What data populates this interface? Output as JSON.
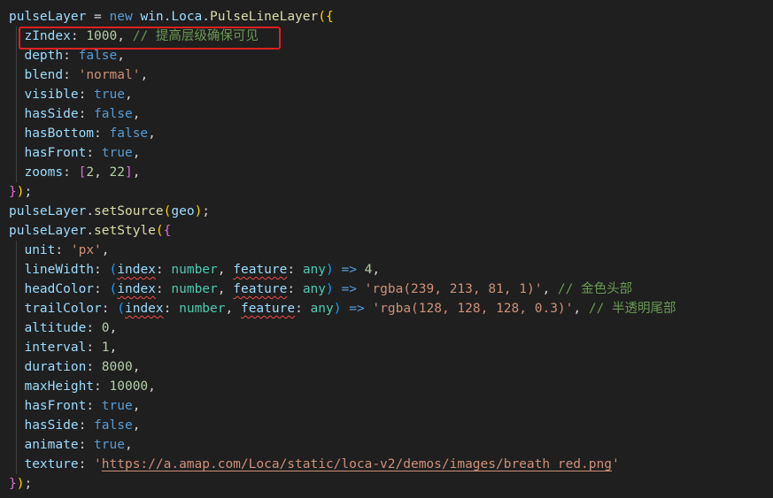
{
  "code": {
    "l1": {
      "var": "pulseLayer",
      "eq": " = ",
      "kw_new": "new",
      "ns": " win.Loca.",
      "cls": "PulseLineLayer",
      "open": "({"
    },
    "l2": {
      "key": "zIndex",
      "colon": ": ",
      "val": "1000",
      "comma": ",",
      "comment": " // 提高层级确保可见"
    },
    "l3": {
      "key": "depth",
      "colon": ": ",
      "val": "false",
      "comma": ","
    },
    "l4": {
      "key": "blend",
      "colon": ": ",
      "val": "'normal'",
      "comma": ","
    },
    "l5": {
      "key": "visible",
      "colon": ": ",
      "val": "true",
      "comma": ","
    },
    "l6": {
      "key": "hasSide",
      "colon": ": ",
      "val": "false",
      "comma": ","
    },
    "l7": {
      "key": "hasBottom",
      "colon": ": ",
      "val": "false",
      "comma": ","
    },
    "l8": {
      "key": "hasFront",
      "colon": ": ",
      "val": "true",
      "comma": ","
    },
    "l9": {
      "key": "zooms",
      "colon": ": ",
      "open": "[",
      "n1": "2",
      "sep": ", ",
      "n2": "22",
      "close": "]",
      "comma": ","
    },
    "l10": {
      "close1": "}",
      "close2": ")",
      "semi": ";"
    },
    "l11": {
      "var": "pulseLayer",
      "dot": ".",
      "fn": "setSource",
      "open": "(",
      "arg": "geo",
      "close": ")",
      "semi": ";"
    },
    "l12": {
      "var": "pulseLayer",
      "dot": ".",
      "fn": "setStyle",
      "open1": "(",
      "open2": "{"
    },
    "l13": {
      "key": "unit",
      "colon": ": ",
      "val": "'px'",
      "comma": ","
    },
    "l14": {
      "key": "lineWidth",
      "colon": ": ",
      "paren": "(",
      "p1": "index",
      "c1": ": ",
      "t1": "number",
      "s": ", ",
      "p2": "feature",
      "c2": ": ",
      "t2": "any",
      "pclose": ")",
      "arrow": " => ",
      "val": "4",
      "comma": ","
    },
    "l15": {
      "key": "headColor",
      "colon": ": ",
      "paren": "(",
      "p1": "index",
      "c1": ": ",
      "t1": "number",
      "s": ", ",
      "p2": "feature",
      "c2": ": ",
      "t2": "any",
      "pclose": ")",
      "arrow": " => ",
      "val": "'rgba(239, 213, 81, 1)'",
      "comma": ",",
      "comment": " // 金色头部"
    },
    "l16": {
      "key": "trailColor",
      "colon": ": ",
      "paren": "(",
      "p1": "index",
      "c1": ": ",
      "t1": "number",
      "s": ", ",
      "p2": "feature",
      "c2": ": ",
      "t2": "any",
      "pclose": ")",
      "arrow": " => ",
      "val": "'rgba(128, 128, 128, 0.3)'",
      "comma": ",",
      "comment": " // 半透明尾部"
    },
    "l17": {
      "key": "altitude",
      "colon": ": ",
      "val": "0",
      "comma": ","
    },
    "l18": {
      "key": "interval",
      "colon": ": ",
      "val": "1",
      "comma": ","
    },
    "l19": {
      "key": "duration",
      "colon": ": ",
      "val": "8000",
      "comma": ","
    },
    "l20": {
      "key": "maxHeight",
      "colon": ": ",
      "val": "10000",
      "comma": ","
    },
    "l21": {
      "key": "hasFront",
      "colon": ": ",
      "val": "true",
      "comma": ","
    },
    "l22": {
      "key": "hasSide",
      "colon": ": ",
      "val": "false",
      "comma": ","
    },
    "l23": {
      "key": "animate",
      "colon": ": ",
      "val": "true",
      "comma": ","
    },
    "l24": {
      "key": "texture",
      "colon": ": ",
      "q1": "'",
      "url": "https://a.amap.com/Loca/static/loca-v2/demos/images/breath_red.png",
      "q2": "'"
    },
    "l25": {
      "close1": "}",
      "close2": ")",
      "semi": ";"
    }
  },
  "colors": {
    "background": "#1f1f1f",
    "highlight_border": "#e02020",
    "variable": "#9cdcfe",
    "keyword": "#569cd6",
    "string": "#ce9178",
    "number": "#b5cea8",
    "comment": "#6a9955",
    "function": "#dcdcaa"
  }
}
